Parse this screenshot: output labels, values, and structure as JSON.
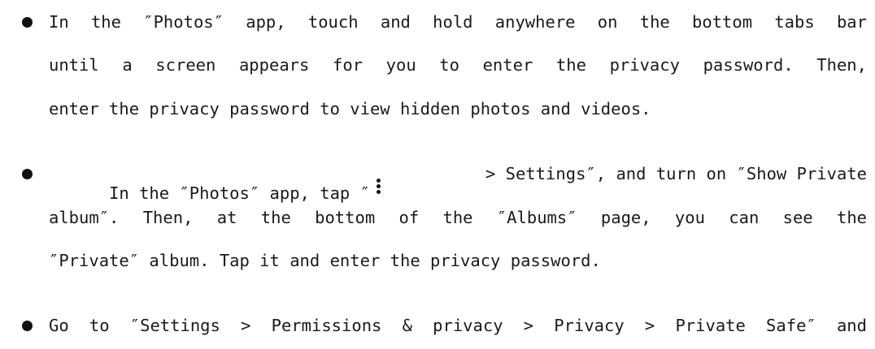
{
  "instructions": [
    {
      "lines": [
        "In the ″Photos″ app, touch and hold anywhere on the bottom tabs bar",
        "until a screen appears for you to enter the privacy password. Then,",
        "enter the privacy password to view hidden photos and videos."
      ]
    },
    {
      "line1_before_icon": "In the ″Photos″ app, tap ″",
      "icon": "more-vertical-icon",
      "line1_after_icon": "> Settings″, and turn on ″Show Private",
      "lines_rest": [
        "album″. Then, at the bottom of the ″Albums″ page, you can see the",
        "″Private″ album. Tap it and enter the privacy password."
      ]
    },
    {
      "lines": [
        "Go to ″Settings > Permissions & privacy > Privacy > Private Safe″ and"
      ]
    }
  ]
}
